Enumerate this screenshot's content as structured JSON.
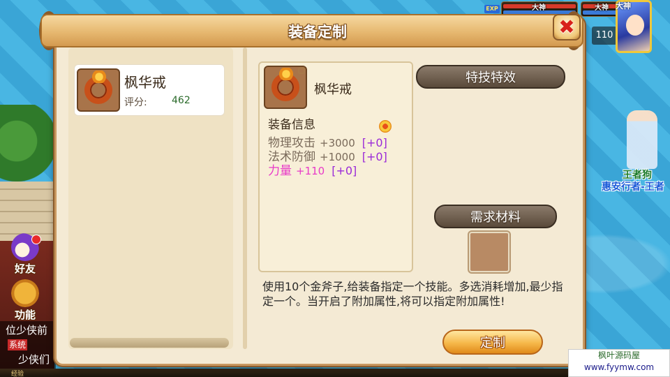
{
  "hud": {
    "exp_tag": "EXP",
    "god_tag_1": "大神",
    "god_tag_2": "大神",
    "level": "110",
    "portrait_tag": "大神"
  },
  "npc": {
    "name": "王者狗",
    "title": "惠安行者-王者"
  },
  "side_buttons": {
    "friends": "好友",
    "functions": "功能"
  },
  "chat": {
    "line1": "位少侠前",
    "system_tag": "系统",
    "line2": "少侠们"
  },
  "footer": {
    "exp_label": "经验"
  },
  "dialog": {
    "title": "装备定制",
    "close_glyph": "✖"
  },
  "item_card": {
    "name": "枫华戒",
    "score_label": "评分:",
    "score_value": "462"
  },
  "detail": {
    "name": "枫华戒",
    "info_header": "装备信息",
    "stats": [
      {
        "name": "物理攻击",
        "value": "+3000",
        "bonus": "[+0]"
      },
      {
        "name": "法术防御",
        "value": "+1000",
        "bonus": "[+0]"
      },
      {
        "name": "力量",
        "value": "+110",
        "bonus": "[+0]"
      }
    ]
  },
  "skill_panel": {
    "header": "特技特效"
  },
  "materials": {
    "header": "需求材料"
  },
  "description": "使用10个金斧子,给装备指定一个技能。多选消耗增加,最少指定一个。当开启了附加属性,将可以指定附加属性!",
  "custom_button": "定制",
  "watermark": {
    "line1": "枫叶源码屋",
    "line2": "www.fyymw.com"
  },
  "colors": {
    "stat_highlight": "#e83ac8",
    "bonus": "#9a2ad8",
    "score": "#2a6a2a",
    "panel_bg": "#f4ead4"
  }
}
